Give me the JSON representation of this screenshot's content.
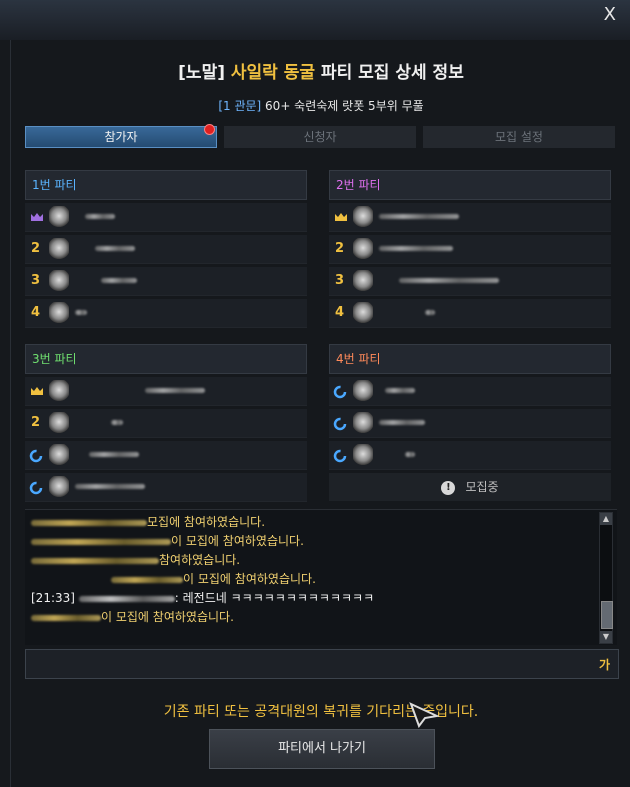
{
  "window": {
    "close_label": "X",
    "title_prefix": "[노말]",
    "title_dungeon": "사일락 동굴",
    "title_suffix": "파티 모집 상세 정보",
    "subtitle_tag": "[1 관문]",
    "subtitle_text": "60+ 숙련숙제 랏폿 5부위 무풀"
  },
  "tabs": [
    {
      "label": "참가자",
      "active": true,
      "has_notification": true
    },
    {
      "label": "신청자",
      "active": false
    },
    {
      "label": "모집 설정",
      "active": false
    }
  ],
  "parties": [
    {
      "label": "1번 파티",
      "color": "#5ab4ff",
      "slots": [
        {
          "marker": "crown-purple"
        },
        {
          "marker": "2"
        },
        {
          "marker": "3"
        },
        {
          "marker": "4"
        }
      ]
    },
    {
      "label": "2번 파티",
      "color": "#e070f0",
      "slots": [
        {
          "marker": "crown"
        },
        {
          "marker": "2"
        },
        {
          "marker": "3"
        },
        {
          "marker": "4"
        }
      ]
    },
    {
      "label": "3번 파티",
      "color": "#70e070",
      "slots": [
        {
          "marker": "crown"
        },
        {
          "marker": "2"
        },
        {
          "marker": "loop"
        },
        {
          "marker": "loop"
        }
      ]
    },
    {
      "label": "4번 파티",
      "color": "#ff8a5a",
      "slots": [
        {
          "marker": "loop"
        },
        {
          "marker": "loop"
        },
        {
          "marker": "loop"
        }
      ],
      "recruiting_label": "모집중"
    }
  ],
  "chat": {
    "lines": [
      {
        "suffix": "모집에 참여하였습니다."
      },
      {
        "suffix": "이 모집에 참여하였습니다."
      },
      {
        "suffix": "참여하였습니다."
      },
      {
        "suffix": "이 모집에 참여하였습니다."
      },
      {
        "time": "[21:33]",
        "message": ": 레전드네 ㅋㅋㅋㅋㅋㅋㅋㅋㅋㅋㅋㅋㅋ"
      },
      {
        "suffix": "이 모집에 참여하였습니다."
      }
    ],
    "input_lang": "가"
  },
  "status_text": "기존 파티 또는 공격대원의 복귀를 기다리는 중입니다.",
  "leave_button_label": "파티에서 나가기"
}
